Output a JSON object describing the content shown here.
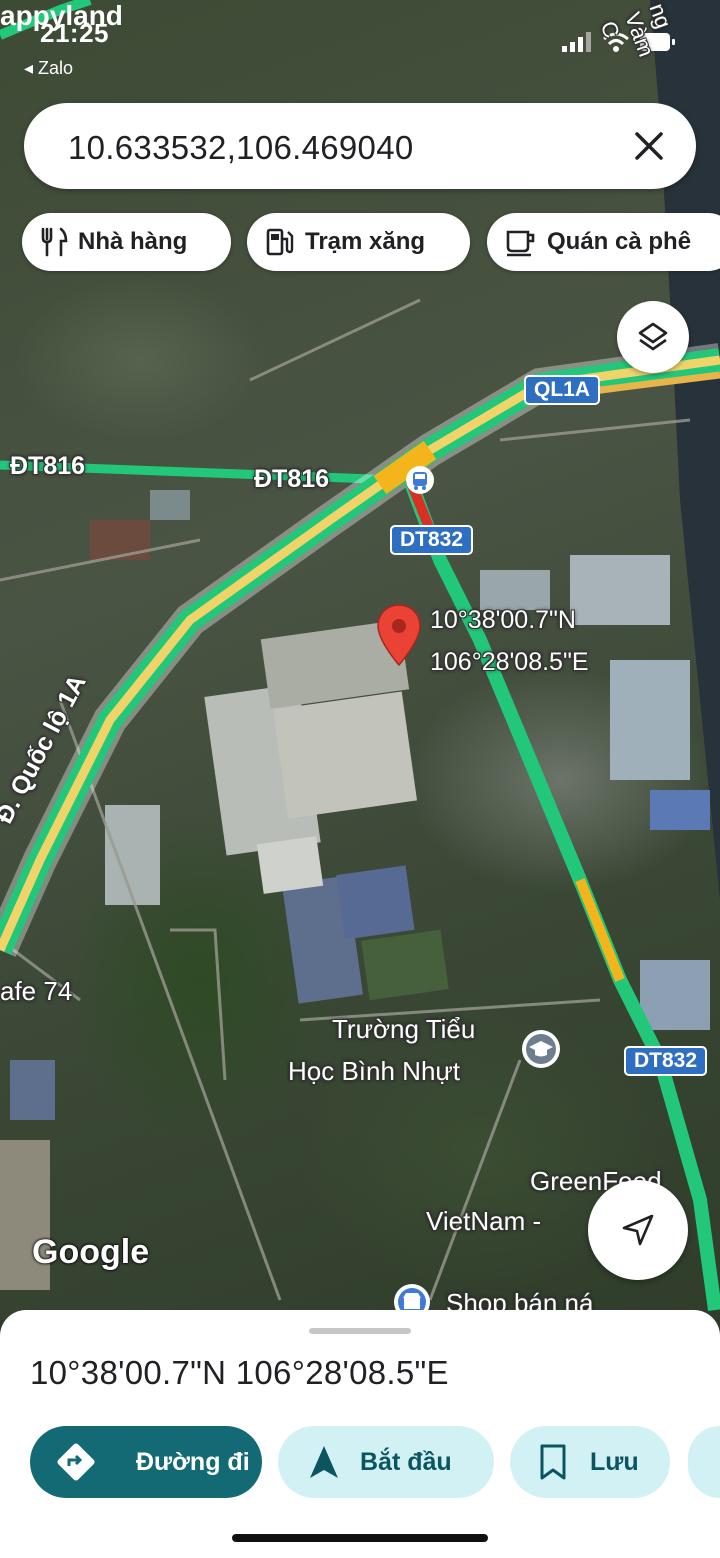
{
  "status_bar": {
    "time": "21:25",
    "back_app": "◂ Zalo",
    "overlay_app_label": "appyland"
  },
  "search": {
    "value": "10.633532,106.469040"
  },
  "chips": [
    {
      "label": "Nhà hàng",
      "icon": "fork-knife-icon"
    },
    {
      "label": "Trạm xăng",
      "icon": "gas-station-icon"
    },
    {
      "label": "Quán cà phê",
      "icon": "coffee-cup-icon"
    }
  ],
  "map": {
    "road_labels": {
      "ql1a": "QL1A",
      "dt832_top": "DT832",
      "dt832_bottom": "DT832"
    },
    "road_names": {
      "dt816_left": "ĐT816",
      "dt816_center": "ĐT816",
      "quoc_lo": "Đ. Quốc lộ 1A"
    },
    "pin_label": {
      "lat": "10°38'00.7\"N",
      "lng": "106°28'08.5\"E"
    },
    "places": {
      "school_line1": "Trường Tiểu",
      "school_line2": "Học Bình Nhựt",
      "cafe": "afe 74",
      "greenfeed_line1": "GreenFeed",
      "greenfeed_line2": "VietNam -",
      "shop": "Shop bán ná"
    },
    "top_right_road": "ng Vàm C",
    "logo": "Google"
  },
  "colors": {
    "traffic_green": "#22c77a",
    "traffic_yellow": "#f3b51b",
    "traffic_red": "#d93025",
    "pin_red": "#ea4335",
    "primary_button": "#146a74",
    "secondary_button": "#d2f1f4",
    "route_shield": "#2f6fc2"
  },
  "sheet": {
    "title": "10°38'00.7\"N 106°28'08.5\"E",
    "actions": [
      {
        "label": "Đường đi",
        "icon": "directions-icon"
      },
      {
        "label": "Bắt đầu",
        "icon": "navigation-arrow-icon"
      },
      {
        "label": "Lưu",
        "icon": "bookmark-icon"
      }
    ]
  }
}
